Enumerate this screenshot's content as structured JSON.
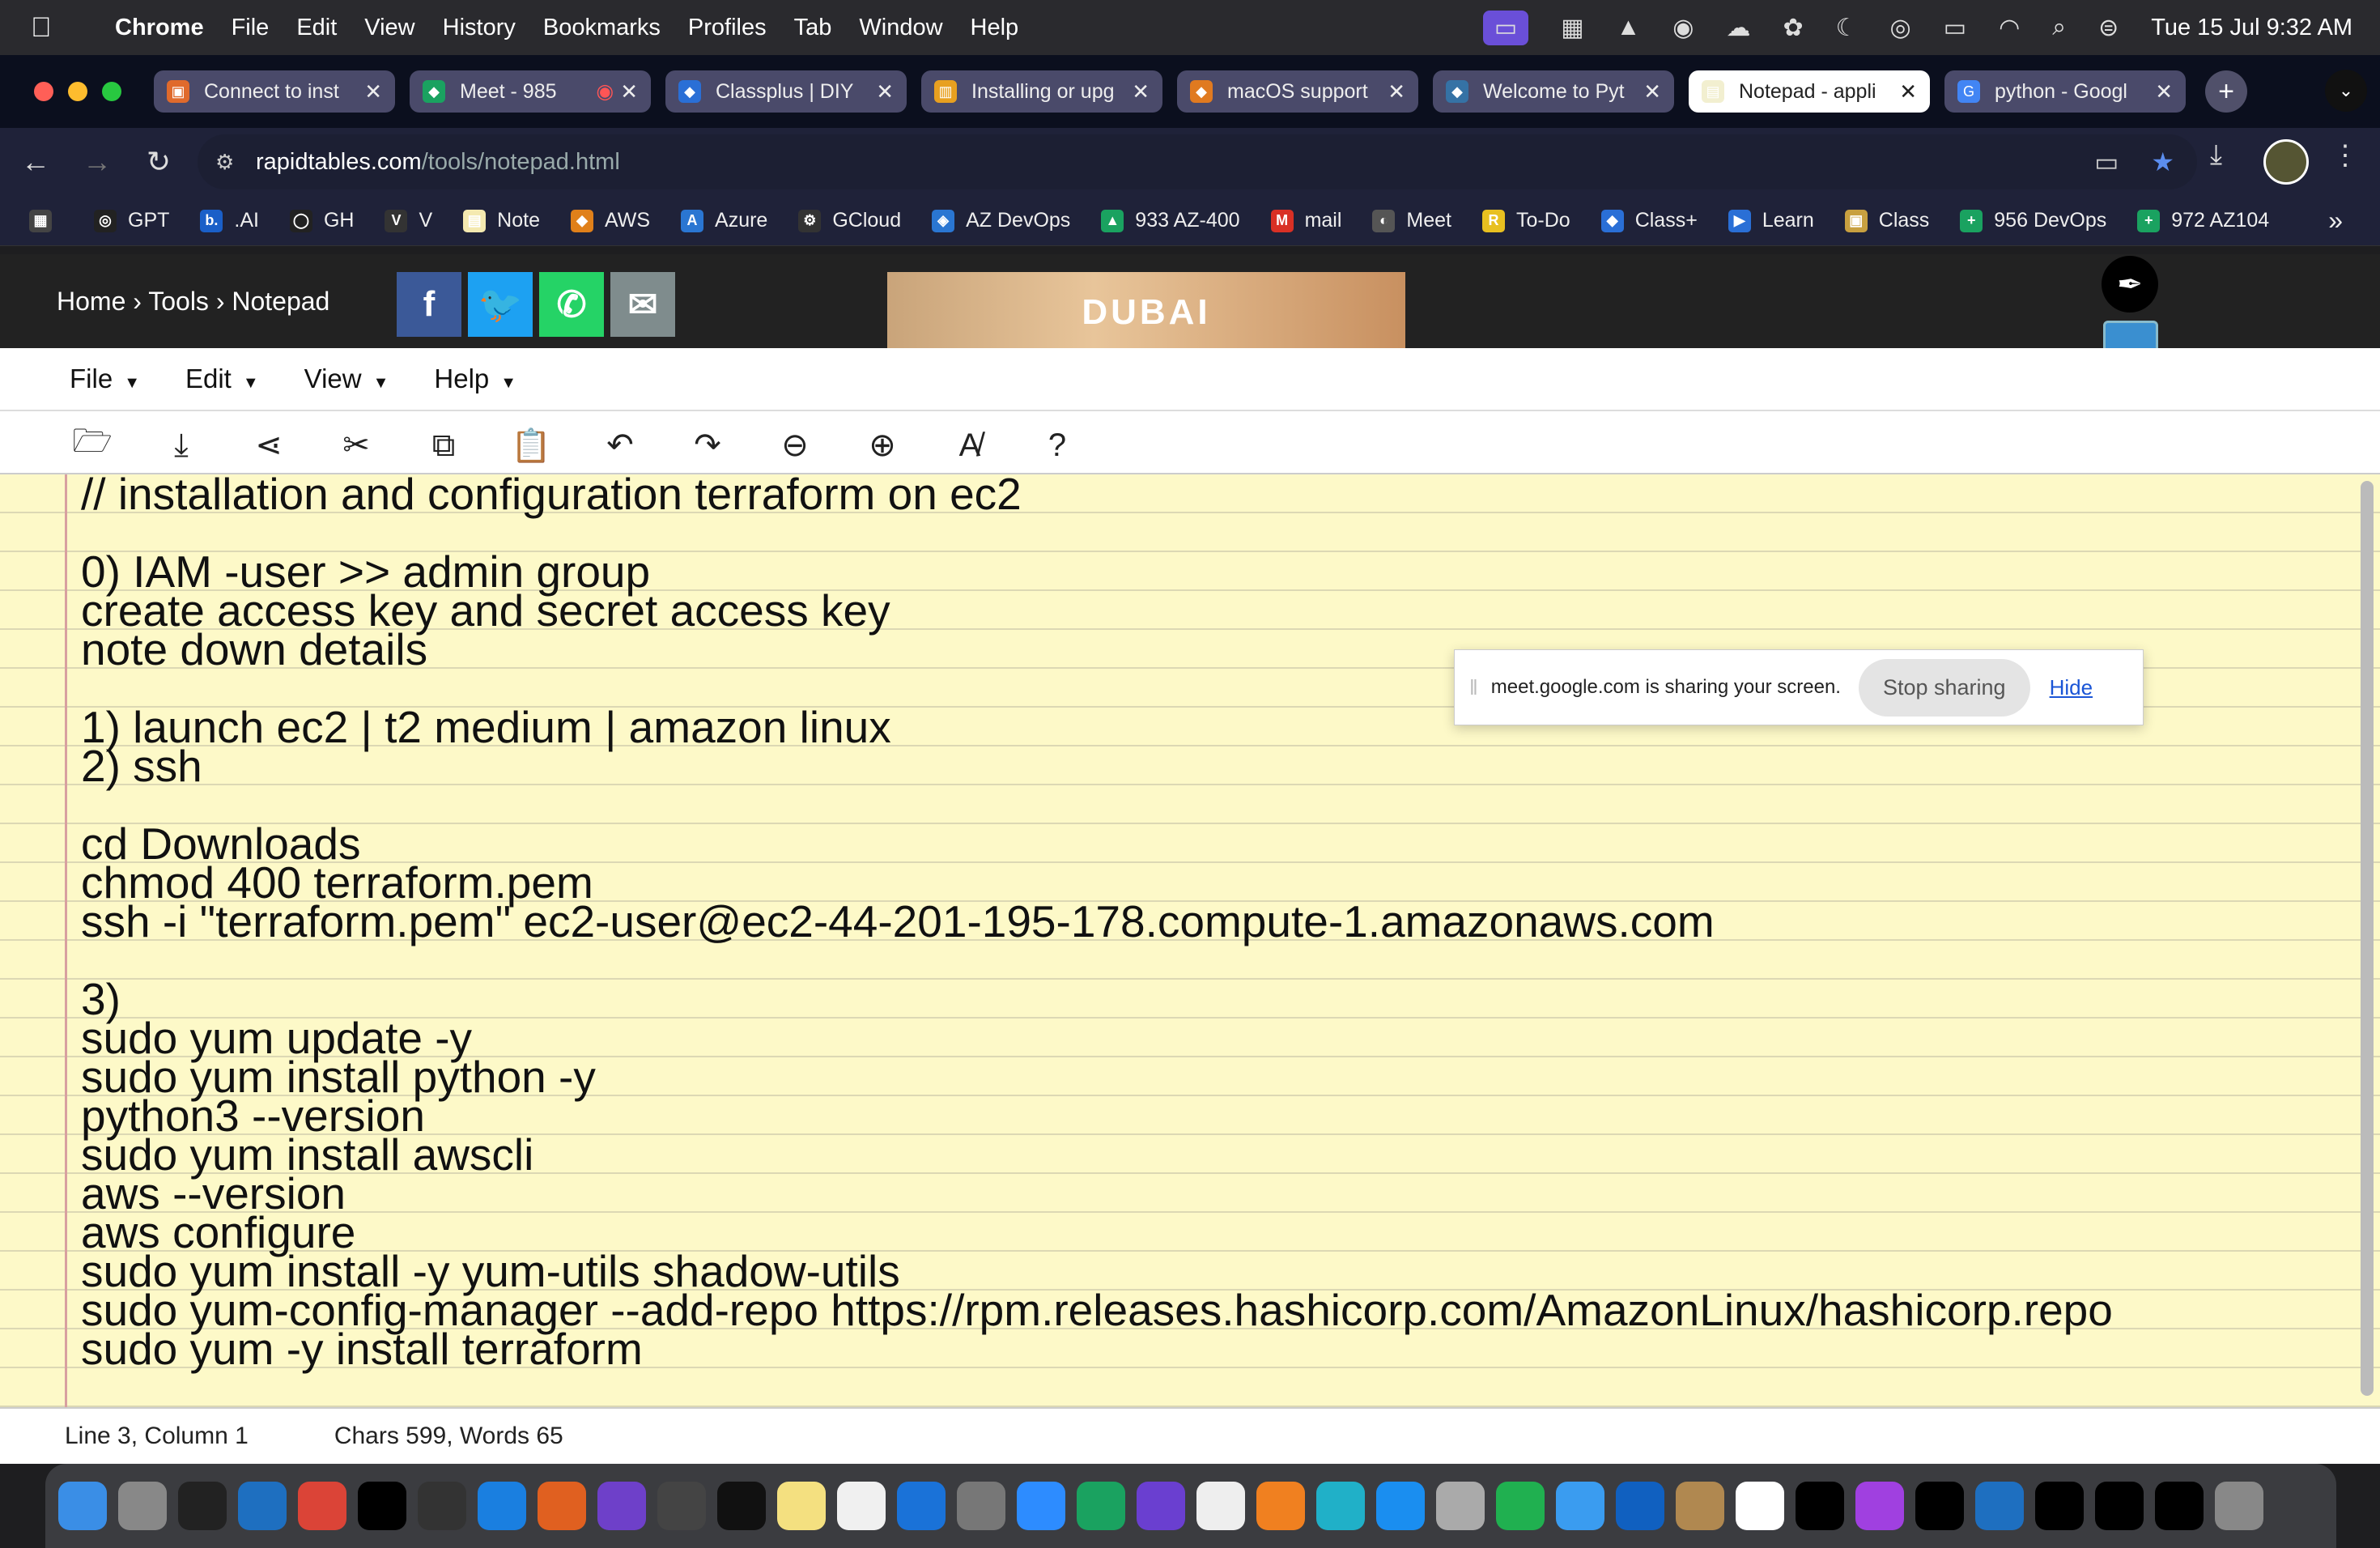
{
  "menubar": {
    "apple": "",
    "items": [
      "Chrome",
      "File",
      "Edit",
      "View",
      "History",
      "Bookmarks",
      "Profiles",
      "Tab",
      "Window",
      "Help"
    ],
    "status_icons": [
      "screen-share-icon",
      "xp-pen-icon",
      "drive-icon",
      "vpn-icon",
      "cloud-icon",
      "chatgpt-icon",
      "moon-icon",
      "airdrop-icon",
      "battery-icon",
      "wifi-icon",
      "search-icon",
      "control-center-icon"
    ],
    "clock": "Tue 15 Jul  9:32 AM"
  },
  "tabs": [
    {
      "label": "Connect to inst",
      "color": "#e06a2c",
      "glyph": "▣"
    },
    {
      "label": "Meet - 985",
      "color": "#1aa260",
      "glyph": "◆",
      "recording": "◉"
    },
    {
      "label": "Classplus | DIY",
      "color": "#2a6fd6",
      "glyph": "◆"
    },
    {
      "label": "Installing or upg",
      "color": "#e8a020",
      "glyph": "▥"
    },
    {
      "label": "macOS support",
      "color": "#e07a20",
      "glyph": "◆"
    },
    {
      "label": "Welcome to Pyt",
      "color": "#3572a5",
      "glyph": "◆"
    },
    {
      "label": "Notepad - appli",
      "color": "#f2efd0",
      "glyph": "▤",
      "active": true
    },
    {
      "label": "python - Googl",
      "color": "#4285f4",
      "glyph": "G"
    }
  ],
  "tab_close": "✕",
  "newtab": "+",
  "tabmenu": "⌄",
  "toolbar": {
    "back": "←",
    "forward": "→",
    "reload": "↻",
    "host": "rapidtables.com",
    "path": "/tools/notepad.html"
  },
  "bookmarks": [
    {
      "label": "",
      "color": "#444",
      "glyph": "▦"
    },
    {
      "label": "GPT",
      "color": "#222",
      "glyph": "◎"
    },
    {
      "label": ".AI",
      "color": "#1a5fc8",
      "glyph": "b."
    },
    {
      "label": "GH",
      "color": "#222",
      "glyph": "◯"
    },
    {
      "label": "V",
      "color": "#333",
      "glyph": "V"
    },
    {
      "label": "Note",
      "color": "#f4e9b0",
      "glyph": "▤"
    },
    {
      "label": "AWS",
      "color": "#e0801a",
      "glyph": "◆"
    },
    {
      "label": "Azure",
      "color": "#2a76d2",
      "glyph": "A"
    },
    {
      "label": "GCloud",
      "color": "#333",
      "glyph": "⚙"
    },
    {
      "label": "AZ DevOps",
      "color": "#2a76d2",
      "glyph": "◈"
    },
    {
      "label": "933 AZ-400",
      "color": "#1aa260",
      "glyph": "▲"
    },
    {
      "label": "mail",
      "color": "#d93025",
      "glyph": "M"
    },
    {
      "label": "Meet",
      "color": "#555",
      "glyph": "◐"
    },
    {
      "label": "To-Do",
      "color": "#e8c020",
      "glyph": "R"
    },
    {
      "label": "Class+",
      "color": "#2a6fd6",
      "glyph": "◆"
    },
    {
      "label": "Learn",
      "color": "#2a6fd6",
      "glyph": "▶"
    },
    {
      "label": "Class",
      "color": "#c8a040",
      "glyph": "▣"
    },
    {
      "label": "956 DevOps",
      "color": "#1aa260",
      "glyph": "+"
    },
    {
      "label": "972 AZ104",
      "color": "#1aa260",
      "glyph": "+"
    }
  ],
  "bookmarks_more": "»",
  "site": {
    "breadcrumb": "Home › Tools › Notepad",
    "share": [
      {
        "name": "facebook",
        "glyph": "f",
        "color": "#3b5998"
      },
      {
        "name": "twitter",
        "glyph": "🐦",
        "color": "#1da1f2"
      },
      {
        "name": "whatsapp",
        "glyph": "✆",
        "color": "#25d366"
      },
      {
        "name": "email",
        "glyph": "✉",
        "color": "#7f8c8d"
      }
    ],
    "ad_text": "DUBAI"
  },
  "app_menu": [
    "File",
    "Edit",
    "View",
    "Help"
  ],
  "tools": [
    "open-icon",
    "download-icon",
    "share-icon",
    "cut-icon",
    "copy-icon",
    "paste-icon",
    "undo-icon",
    "redo-icon",
    "zoom-out-icon",
    "zoom-in-icon",
    "spellcheck-icon",
    "help-icon"
  ],
  "tool_glyphs": [
    "🗁",
    "⤓",
    "⋖",
    "✂",
    "⧉",
    "📋",
    "↶",
    "↷",
    "⊖",
    "⊕",
    "A̸",
    "?"
  ],
  "editor_text": "// installation and configuration terraform on ec2\n\n0) IAM -user >> admin group\ncreate access key and secret access key\nnote down details\n\n1) launch ec2 | t2 medium | amazon linux\n2) ssh\n\ncd Downloads\nchmod 400 terraform.pem\nssh -i \"terraform.pem\" ec2-user@ec2-44-201-195-178.compute-1.amazonaws.com\n\n3)\nsudo yum update -y\nsudo yum install python -y\npython3 --version\nsudo yum install awscli\naws --version\naws configure\nsudo yum install -y yum-utils shadow-utils\nsudo yum-config-manager --add-repo https://rpm.releases.hashicorp.com/AmazonLinux/hashicorp.repo\nsudo yum -y install terraform",
  "share_popup": {
    "message": "meet.google.com is sharing your screen.",
    "stop": "Stop sharing",
    "hide": "Hide"
  },
  "status": {
    "position": "Line 3, Column 1",
    "counts": "Chars 599, Words 65"
  },
  "dock": [
    {
      "name": "finder",
      "color": "#3a8ee6"
    },
    {
      "name": "launchpad",
      "color": "#888"
    },
    {
      "name": "chatgpt-desktop",
      "color": "#222"
    },
    {
      "name": "vscode",
      "color": "#1e6fc0"
    },
    {
      "name": "chrome",
      "color": "#db4437"
    },
    {
      "name": "xp-pen",
      "color": "#000"
    },
    {
      "name": "openai",
      "color": "#333"
    },
    {
      "name": "safari",
      "color": "#1a7fe0"
    },
    {
      "name": "office",
      "color": "#e06020"
    },
    {
      "name": "github",
      "color": "#6e40c9"
    },
    {
      "name": "screenshot",
      "color": "#444"
    },
    {
      "name": "terminal",
      "color": "#111"
    },
    {
      "name": "notes",
      "color": "#f4e080"
    },
    {
      "name": "freeform",
      "color": "#f0f0f0"
    },
    {
      "name": "onedrive",
      "color": "#1a72d8"
    },
    {
      "name": "settings",
      "color": "#777"
    },
    {
      "name": "zoom",
      "color": "#2d8cff"
    },
    {
      "name": "drive",
      "color": "#1aa260"
    },
    {
      "name": "imovie",
      "color": "#6a3fd0"
    },
    {
      "name": "reminders",
      "color": "#eee"
    },
    {
      "name": "pages",
      "color": "#f08020"
    },
    {
      "name": "canva",
      "color": "#20b0c8"
    },
    {
      "name": "appstore",
      "color": "#1a8ef0"
    },
    {
      "name": "preview",
      "color": "#aaa"
    },
    {
      "name": "numbers",
      "color": "#20b050"
    },
    {
      "name": "mail",
      "color": "#3a9cf0"
    },
    {
      "name": "outlook",
      "color": "#1060c0"
    },
    {
      "name": "contacts",
      "color": "#b08850"
    },
    {
      "name": "calendar",
      "color": "#fff"
    },
    {
      "name": "xp-pen-2",
      "color": "#000"
    },
    {
      "name": "podcasts",
      "color": "#a040e0"
    },
    {
      "name": "xp-pen-3",
      "color": "#000"
    },
    {
      "name": "vscode-2",
      "color": "#1e6fc0"
    },
    {
      "name": "xp-pen-4",
      "color": "#000"
    },
    {
      "name": "xp-pen-5",
      "color": "#000"
    },
    {
      "name": "xp-pen-6",
      "color": "#000"
    },
    {
      "name": "trash",
      "color": "#888"
    }
  ]
}
